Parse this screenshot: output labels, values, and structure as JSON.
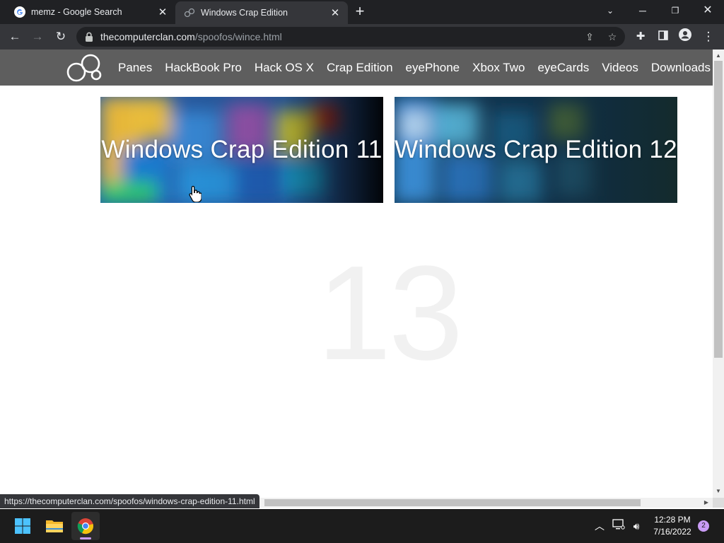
{
  "browser": {
    "tabs": [
      {
        "title": "memz - Google Search",
        "favicon": "google-icon",
        "active": false
      },
      {
        "title": "Windows Crap Edition",
        "favicon": "site-logo-icon",
        "active": true
      }
    ],
    "address": {
      "host": "thecomputerclan.com",
      "path": "/spoofos/wince.html"
    },
    "status_url": "https://thecomputerclan.com/spoofos/windows-crap-edition-11.html"
  },
  "site": {
    "nav": [
      "Panes",
      "HackBook Pro",
      "Hack OS X",
      "Crap Edition",
      "eyePhone",
      "Xbox Two",
      "eyeCards",
      "Videos",
      "Downloads"
    ],
    "cards": [
      {
        "label": "Windows Crap Edition 11"
      },
      {
        "label": "Windows Crap Edition 12"
      }
    ],
    "watermark": "13"
  },
  "taskbar": {
    "apps": [
      "windows-start-icon",
      "file-explorer-icon",
      "chrome-icon"
    ],
    "time": "12:28 PM",
    "date": "7/16/2022",
    "notifications": "2"
  },
  "colors": {
    "chrome_dark": "#202124",
    "chrome_toolbar": "#35363a",
    "site_nav": "#5e5e5e",
    "accent": "#c99cf5"
  }
}
